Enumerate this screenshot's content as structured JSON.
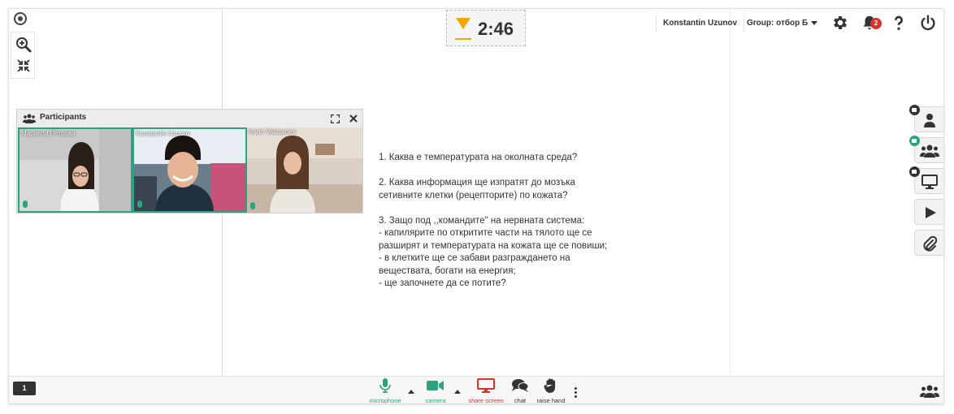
{
  "timer": {
    "time": "2:46"
  },
  "header": {
    "user_name": "Konstantin Uzunov",
    "group_label": "Group: отбор Б",
    "notification_count": "2"
  },
  "participants": {
    "title": "Participants",
    "tiles": [
      {
        "name": "Мариела Петрова"
      },
      {
        "name": "Konstantin Uzunov"
      },
      {
        "name": "Karin Velizarova"
      }
    ]
  },
  "content": {
    "lines": [
      "1. Каква е температурата на околната среда?",
      "",
      "2. Каква информация ще изпратят до мозъка",
      "сетивните клетки (рецепторите) по кожата?",
      "",
      "3. Защо под ,,командите\" на нервната система:",
      "- капилярите по откритите части на тялото ще се",
      "разширят и температурата на кожата ще се повиши;",
      "- в клетките ще се забави разграждането на",
      "веществата, богати на енергия;",
      "- ще започнете да се потите?"
    ]
  },
  "bottom": {
    "page_number": "1",
    "microphone_label": "microphone",
    "camera_label": "camera",
    "share_screen_label": "share screen",
    "chat_label": "chat",
    "raise_hand_label": "raise hand"
  },
  "colors": {
    "accent_green": "#2aa37e",
    "timer_orange": "#f0a800",
    "share_red": "#d9342b",
    "badge_red": "#d9342b"
  }
}
